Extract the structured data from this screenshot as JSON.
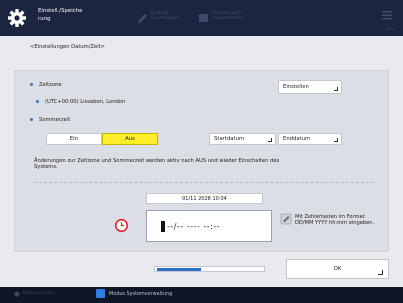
{
  "header": {
    "title": "Einstell./Speiche rung",
    "shortcut1": "Eingabe Einstellungen",
    "shortcut2": "Einstellungen Kassenbereich",
    "menu_label": "Menü"
  },
  "breadcrumb": "<Einstellungen Datum/Zeit>",
  "timezone": {
    "label": "Zeitzone",
    "value": "(UTC+00:00) Lissabon, London",
    "button": "Einstellen"
  },
  "dst": {
    "label": "Sommerzeit",
    "on_label": "Ein",
    "off_label": "Aus",
    "selected": "Aus",
    "start_button": "Startdatum",
    "end_button": "Enddatum"
  },
  "note": "Änderungen zur Zeitzone und Sommerzeit werden aktiv nach AUS und wieder Einschalten des Systems.",
  "current_datetime": "01/11 2028 10:04",
  "entry": {
    "value": "--/-- ---- --:--"
  },
  "hint": "Mit Zehlertasten im Format DD/MM YYYY hh:mm eingeben.",
  "progress": 0.4,
  "ok_label": "OK",
  "footer": {
    "monitor_label": "Statusmonitor",
    "mode_label": "Modus Systemverwaltung"
  },
  "colors": {
    "header_bg": "#1b2540",
    "accent": "#2d7bd0",
    "selected_toggle": "#ffed2a",
    "alert_red": "#e0242b"
  }
}
